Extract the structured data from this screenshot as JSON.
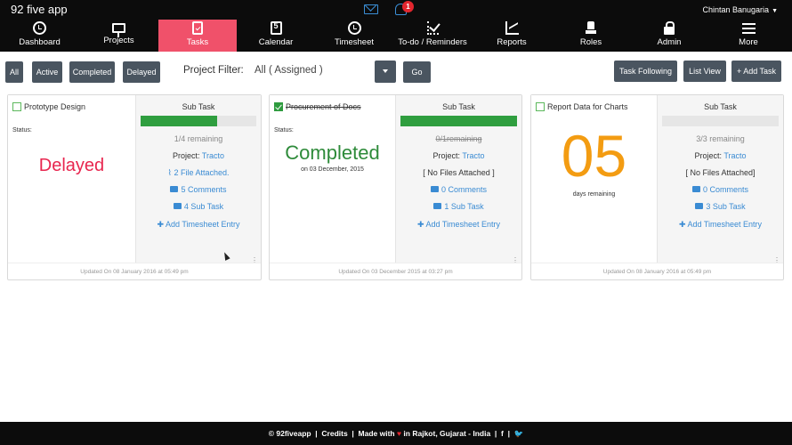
{
  "header": {
    "logo": "92 five app",
    "notification_count": "1",
    "user_name": "Chintan Banugaria"
  },
  "nav": {
    "items": [
      {
        "label": "Dashboard",
        "icon": "clock-icon"
      },
      {
        "label": "Projects",
        "icon": "board-icon"
      },
      {
        "label": "Tasks",
        "icon": "clipboard-icon",
        "active": true
      },
      {
        "label": "Calendar",
        "icon": "calendar-icon"
      },
      {
        "label": "Timesheet",
        "icon": "clock-icon"
      },
      {
        "label": "To-do / Reminders",
        "icon": "checklist-icon"
      },
      {
        "label": "Reports",
        "icon": "chart-icon"
      },
      {
        "label": "Roles",
        "icon": "chess-icon"
      },
      {
        "label": "Admin",
        "icon": "lock-icon"
      },
      {
        "label": "More",
        "icon": "menu-icon"
      }
    ],
    "active_color": "#f0516a"
  },
  "filters": {
    "all": "All",
    "active": "Active",
    "completed": "Completed",
    "delayed": "Delayed",
    "project_filter_label": "Project Filter:",
    "project_filter_value": "All ( Assigned )",
    "go": "Go",
    "task_following": "Task Following",
    "list_view": "List View",
    "add_task": "+ Add Task"
  },
  "cards": [
    {
      "title": "Prototype Design",
      "checked": false,
      "status_label": "Status:",
      "status_text": "Delayed",
      "sub_task_header": "Sub Task",
      "progress": 0.66,
      "remaining": "1/4 remaining",
      "project_label": "Project:",
      "project_name": "Tracto",
      "files": "2 File Attached.",
      "comments": "5 Comments",
      "subtasks": "4 Sub Task",
      "timesheet": "Add Timesheet Entry",
      "updated": "Updated On 08 January 2016 at 05:49 pm"
    },
    {
      "title": "Procurement of Docs",
      "checked": true,
      "status_label": "Status:",
      "status_text": "Completed",
      "completed_on": "on 03 December, 2015",
      "sub_task_header": "Sub Task",
      "progress": 1.0,
      "remaining": "0/1remaining",
      "project_label": "Project:",
      "project_name": "Tracto",
      "files": "[ No Files Attached ]",
      "comments": "0 Comments",
      "subtasks": "1 Sub Task",
      "timesheet": "Add Timesheet Entry",
      "updated": "Updated On 03 December 2015 at 03:27 pm"
    },
    {
      "title": "Report Data for Charts",
      "checked": false,
      "days_number": "05",
      "days_label": "days remaining",
      "sub_task_header": "Sub Task",
      "progress": 0.0,
      "remaining": "3/3 remaining",
      "project_label": "Project:",
      "project_name": "Tracto",
      "files": "[ No Files Attached]",
      "comments": "0 Comments",
      "subtasks": "3 Sub Task",
      "timesheet": "Add Timesheet Entry",
      "updated": "Updated On 08 January 2016 at 05:49 pm"
    }
  ],
  "footer": {
    "brand": "92fiveapp",
    "credits": "Credits",
    "made_with": "Made with",
    "location": "in Rajkot, Gujarat - India",
    "facebook": "f",
    "twitter": "t"
  }
}
